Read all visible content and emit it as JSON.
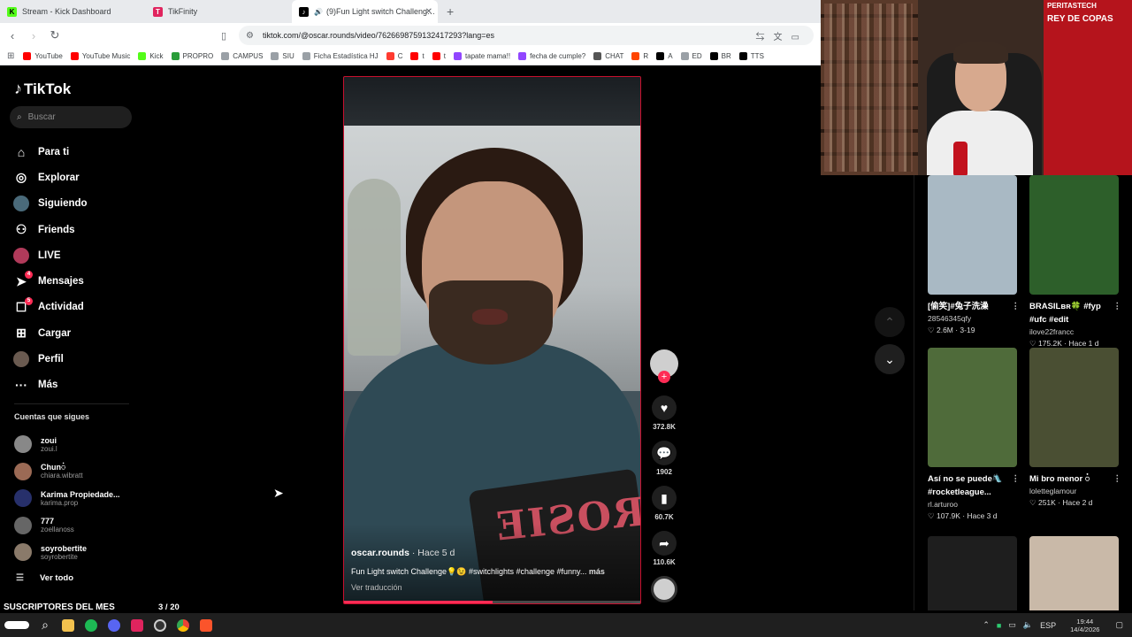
{
  "browser": {
    "tabs": [
      {
        "label": "Stream - Kick Dashboard",
        "color": "#53fc18",
        "glyph": "K"
      },
      {
        "label": "TikFinity",
        "color": "#e0245e",
        "glyph": "T"
      },
      {
        "label": "(9)Fun Light switch Challeng…",
        "color": "#000000",
        "glyph": "♪",
        "active": true
      }
    ],
    "new_tab": "+",
    "close": "✕",
    "url": "tiktok.com/@oscar.rounds/video/7626698759132417293?lang=es",
    "bookmarks": [
      {
        "label": "YouTube",
        "color": "#ff0000"
      },
      {
        "label": "YouTube Music",
        "color": "#ff0000"
      },
      {
        "label": "Kick",
        "color": "#53fc18"
      },
      {
        "label": "PROPRO",
        "color": "#2a9d3a"
      },
      {
        "label": "CAMPUS",
        "color": "#9aa0a6"
      },
      {
        "label": "SIU",
        "color": "#9aa0a6"
      },
      {
        "label": "Ficha Estadística HJ",
        "color": "#9aa0a6"
      },
      {
        "label": "C",
        "color": "#ff3b30"
      },
      {
        "label": "t",
        "color": "#ff0000"
      },
      {
        "label": "t",
        "color": "#ff0000"
      },
      {
        "label": "tapate mama!!",
        "color": "#9146ff"
      },
      {
        "label": "fecha de cumple?",
        "color": "#9146ff"
      },
      {
        "label": "CHAT",
        "color": "#555555"
      },
      {
        "label": "R",
        "color": "#ff4500"
      },
      {
        "label": "A",
        "color": "#000000"
      },
      {
        "label": "ED",
        "color": "#9aa0a6"
      },
      {
        "label": "BR",
        "color": "#000000"
      },
      {
        "label": "TTS",
        "color": "#000000"
      }
    ]
  },
  "tiktok": {
    "logo": "TikTok",
    "search_placeholder": "Buscar",
    "nav": [
      {
        "label": "Para ti",
        "icon": "home-icon",
        "glyph": "⌂"
      },
      {
        "label": "Explorar",
        "icon": "compass-icon",
        "glyph": "◎"
      },
      {
        "label": "Siguiendo",
        "icon": "following-avatar-icon",
        "glyph": ""
      },
      {
        "label": "Friends",
        "icon": "friends-icon",
        "glyph": "⚇"
      },
      {
        "label": "LIVE",
        "icon": "live-avatar-icon",
        "glyph": ""
      },
      {
        "label": "Mensajes",
        "icon": "messages-icon",
        "glyph": "➤",
        "badge": "4"
      },
      {
        "label": "Actividad",
        "icon": "activity-icon",
        "glyph": "☐",
        "badge": "5"
      },
      {
        "label": "Cargar",
        "icon": "upload-icon",
        "glyph": "⊞"
      },
      {
        "label": "Perfil",
        "icon": "profile-avatar-icon",
        "glyph": ""
      },
      {
        "label": "Más",
        "icon": "more-icon",
        "glyph": "···"
      }
    ],
    "following_title": "Cuentas que sigues",
    "following": [
      {
        "name": "zoui",
        "user": "zoui.l",
        "color": "#888888"
      },
      {
        "name": "Chun𑀁",
        "user": "chiara.wibratt",
        "color": "#9b6a55"
      },
      {
        "name": "Karima Propiedade...",
        "user": "karima.prop",
        "color": "#27306b"
      },
      {
        "name": "777",
        "user": "zoellanoss",
        "color": "#666666"
      },
      {
        "name": "soyrobertite",
        "user": "soyrobertite",
        "color": "#8a7a6a"
      }
    ],
    "see_all": "Ver todo"
  },
  "video": {
    "author": "oscar.rounds",
    "ago": " · Hace 5 d",
    "caption": "Fun Light switch Challenge💡😉 #switchlights #challenge #funny...",
    "more": "más",
    "translate": "Ver traducción",
    "progress": 0.5,
    "shorts_print": "ROSIE"
  },
  "actions": {
    "likes": "372.8K",
    "comments": "1902",
    "saves": "60.7K",
    "shares": "110.6K"
  },
  "feed": [
    {
      "title": "[偷笑]#兔子洗澡",
      "user": "28546345qfy",
      "meta": "♡ 2.6M · 3-19",
      "thumb": "#a9b9c4"
    },
    {
      "title": "BRASILʙʀ🍀 #fyp #ufc #edit",
      "user": "ilove22francc",
      "meta": "♡ 175.2K · Hace 1 d",
      "thumb": "#2d5f2a"
    },
    {
      "title": "Así no se puede🛝 #rocketleague...",
      "user": "rl.arturoo",
      "meta": "♡ 107.9K · Hace 3 d",
      "thumb": "#4f6b3a"
    },
    {
      "title": "Mi bro menor 𑀁𑀁",
      "user": "loletteglamour",
      "meta": "♡ 251K · Hace 2 d",
      "thumb": "#4a4f33"
    },
    {
      "title": "",
      "user": "",
      "meta": "",
      "thumb": "#1e1e1e"
    },
    {
      "title": "",
      "user": "",
      "meta": "",
      "thumb": "#c9b9a8"
    }
  ],
  "overlay": {
    "subs_label": "SUSCRIPTORES DEL MES",
    "subs_count": "3 / 20",
    "banner_top": "PERITASTECH",
    "banner_big": "REY DE COPAS"
  },
  "taskbar": {
    "lang": "ESP",
    "time": "19:44",
    "date": "14/4/2026"
  }
}
